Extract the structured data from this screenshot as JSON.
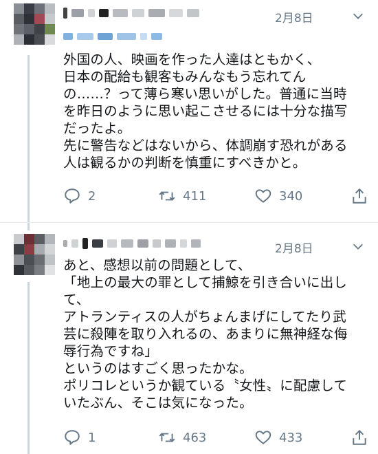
{
  "tweets": [
    {
      "date": "2月8日",
      "text": "外国の人、映画を作った人達はともかく、\n日本の配給も観客もみんなもう忘れてん\nの……？って薄ら寒い思いがした。普通に当時\nを昨日のように思い起こさせるには十分な描写\nだったよ。\n先に警告などはないから、体調崩す恐れがある\n人は観るかの判断を慎重にすべきかと。",
      "reply_count": "2",
      "retweet_count": "411",
      "like_count": "340"
    },
    {
      "date": "2月8日",
      "text": "あと、感想以前の問題として、\n「地上の最大の罪として捕鯨を引き合いに出し\nて、\nアトランティスの人がちょんまげにしてたり武\n芸に殺陣を取り入れるの、あまりに無神経な侮\n辱行為ですね」\nというのはすごく思ったかな。\nポリコレというか観ている〝女性〟に配慮して\nいたぶん、そこは気になった。",
      "reply_count": "1",
      "retweet_count": "463",
      "like_count": "433"
    }
  ],
  "icons": {
    "reply": "reply-icon",
    "retweet": "retweet-icon",
    "like": "heart-icon",
    "share": "share-icon",
    "menu": "chevron-down-icon"
  },
  "colors": {
    "text": "#14171a",
    "secondary": "#657786",
    "thread_line": "#ccd6dd",
    "divider": "#e6ecf0"
  }
}
